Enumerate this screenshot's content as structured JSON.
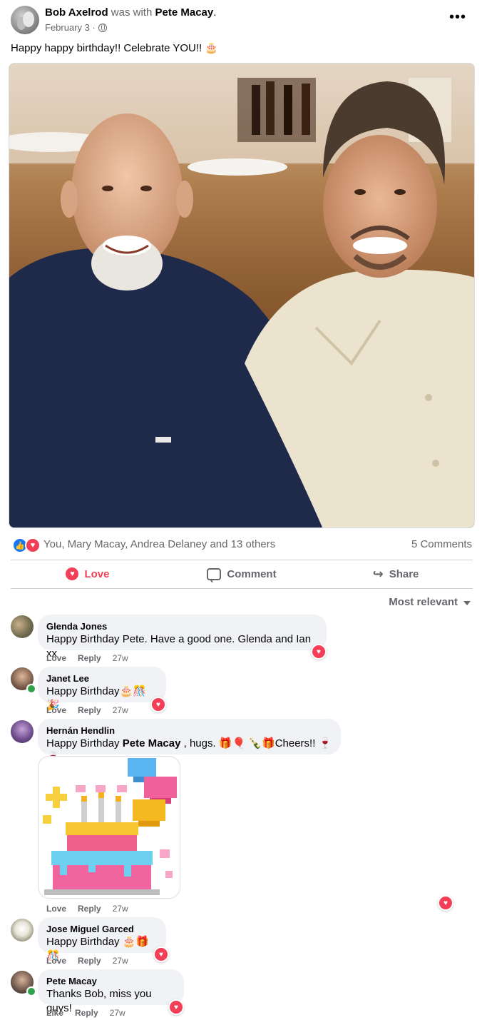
{
  "post": {
    "author": "Bob Axelrod",
    "with_text": "was with",
    "tagged": "Pete Macay",
    "period": ".",
    "date": "February 3 ·",
    "caption": "Happy happy birthday!! Celebrate YOU!! 🎂",
    "more_label": "•••"
  },
  "reactions": {
    "summary": "You, Mary Macay, Andrea Delaney and 13 others",
    "comments": "5 Comments",
    "like_glyph": "👍",
    "love_glyph": "♥"
  },
  "actions": {
    "love": "Love",
    "comment": "Comment",
    "share": "Share"
  },
  "sort_label": "Most relevant",
  "comments": [
    {
      "name": "Glenda Jones",
      "text": "Happy Birthday Pete. Have a good one. Glenda and Ian xx",
      "action1": "Love",
      "reply": "Reply",
      "time": "27w"
    },
    {
      "name": "Janet Lee",
      "text": "Happy Birthday🎂🎊🎉",
      "action1": "Love",
      "reply": "Reply",
      "time": "27w"
    },
    {
      "name": "Hernán Hendlin",
      "text_before": "Happy Birthday ",
      "mention": "Pete Macay",
      "text_after": " , hugs. 🎁🎈 🍾🎁Cheers!! 🍷🍷",
      "action1": "Love",
      "reply": "Reply",
      "time": "27w"
    },
    {
      "name": "Jose Miguel Garced",
      "text": "Happy Birthday 🎂🎁🎊",
      "action1": "Love",
      "reply": "Reply",
      "time": "27w"
    },
    {
      "name": "Pete Macay",
      "text": "Thanks Bob, miss you guys!",
      "action1": "Like",
      "reply": "Reply",
      "time": "27w"
    }
  ],
  "colors": {
    "accent_blue": "#1877f2",
    "love_red": "#f33e58",
    "muted_text": "#65676b",
    "bubble_bg": "#f0f2f5"
  }
}
